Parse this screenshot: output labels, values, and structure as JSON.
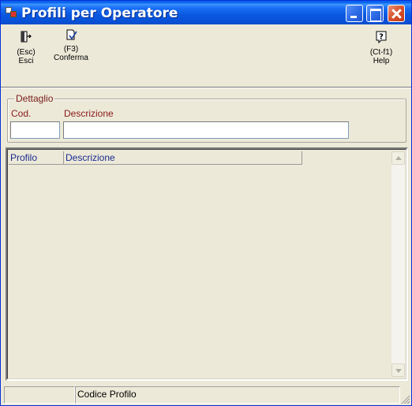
{
  "window": {
    "title": "Profili per Operatore"
  },
  "toolbar": {
    "esci": {
      "key": "(Esc)",
      "label": "Esci",
      "icon": "exit-door-icon"
    },
    "conferma": {
      "key": "(F3)",
      "label": "Conferma",
      "icon": "confirm-check-icon"
    },
    "help": {
      "key": "(Ct-f1)",
      "label": "Help",
      "icon": "help-question-icon"
    }
  },
  "dettaglio": {
    "title": "Dettaglio",
    "cod_label": "Cod.",
    "descrizione_label": "Descrizione",
    "cod_value": "",
    "descrizione_value": ""
  },
  "grid": {
    "columns": [
      "Profilo",
      "Descrizione"
    ],
    "rows": []
  },
  "statusbar": {
    "panel1": "",
    "panel2": "Codice Profilo"
  },
  "colors": {
    "titlebar": "#0A58E0",
    "label_red": "#8B1A1A",
    "header_blue": "#1B2B8F",
    "window_bg": "#ECE9D8"
  }
}
